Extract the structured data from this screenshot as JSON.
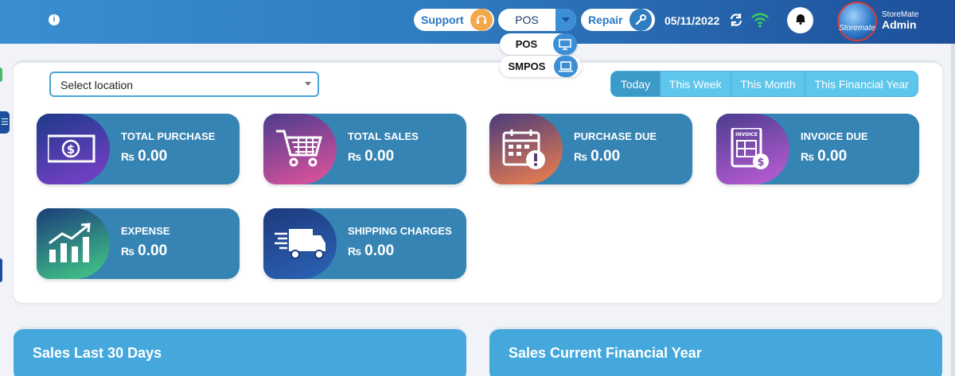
{
  "header": {
    "support_label": "Support",
    "pos_label": "POS",
    "repair_label": "Repair",
    "date": "05/11/2022",
    "avatar_text": "Storemate",
    "user_sub": "StoreMate",
    "user_name": "Admin"
  },
  "pos_menu": {
    "items": [
      {
        "label": "POS",
        "icon": "monitor-icon"
      },
      {
        "label": "SMPOS",
        "icon": "laptop-icon"
      }
    ]
  },
  "filters": {
    "location_placeholder": "Select location",
    "ranges": [
      "Today",
      "This Week",
      "This Month",
      "This Financial Year"
    ],
    "active_range": "Today"
  },
  "currency": "₨",
  "cards": [
    {
      "title": "TOTAL PURCHASE",
      "value": "0.00",
      "icon": "cash-icon"
    },
    {
      "title": "TOTAL SALES",
      "value": "0.00",
      "icon": "cart-icon"
    },
    {
      "title": "PURCHASE DUE",
      "value": "0.00",
      "icon": "calendar-alert-icon"
    },
    {
      "title": "INVOICE DUE",
      "value": "0.00",
      "icon": "invoice-icon",
      "icon_text": "INVOICE"
    },
    {
      "title": "EXPENSE",
      "value": "0.00",
      "icon": "chart-growth-icon"
    },
    {
      "title": "SHIPPING CHARGES",
      "value": "0.00",
      "icon": "truck-icon"
    }
  ],
  "sections": {
    "sales_30_days": "Sales Last 30 Days",
    "sales_financial_year": "Sales Current Financial Year"
  },
  "colors": {
    "header_start": "#3a8fd0",
    "header_end": "#1d4f9a",
    "card_bg": "#3584b4",
    "support_accent": "#f2a94e",
    "section_bg": "#45a8dc"
  }
}
